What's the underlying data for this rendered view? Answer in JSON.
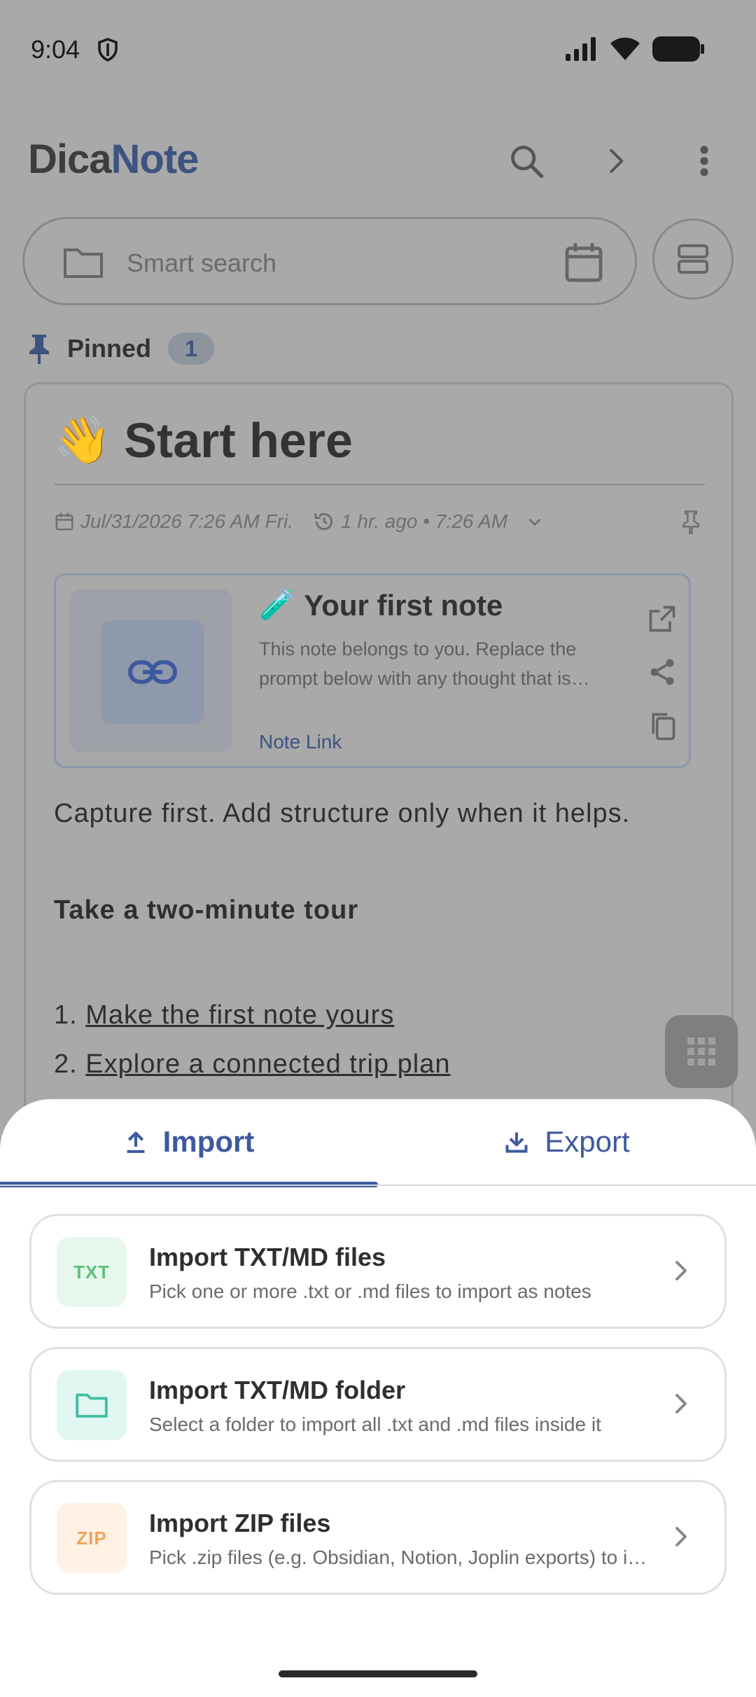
{
  "status_bar": {
    "time": "9:04"
  },
  "header": {
    "logo_part1": "Dica",
    "logo_part2": "Note"
  },
  "search": {
    "placeholder": "Smart search"
  },
  "pinned": {
    "label": "Pinned",
    "count": "1"
  },
  "note": {
    "emoji": "👋",
    "title": "Start here",
    "date": "Jul/31/2026 7:26 AM Fri.",
    "updated": "1 hr. ago • 7:26 AM",
    "link_card": {
      "emoji": "🧪",
      "title": "Your first note",
      "description": "This note belongs to you. Replace the prompt below with any thought that is…",
      "label": "Note Link"
    },
    "body_line": "Capture first. Add structure only when it helps.",
    "tour_heading": "Take a two-minute tour",
    "tour_items": [
      {
        "num": "1.",
        "text": "Make the first note yours"
      },
      {
        "num": "2.",
        "text": "Explore a connected trip plan"
      }
    ]
  },
  "sheet": {
    "tabs": {
      "import": "Import",
      "export": "Export",
      "active": "import"
    },
    "options": [
      {
        "badge": "TXT",
        "title": "Import TXT/MD files",
        "subtitle": "Pick one or more .txt or .md files to import as notes",
        "icon": "txt-badge-icon"
      },
      {
        "badge": "",
        "title": "Import TXT/MD folder",
        "subtitle": "Select a folder to import all .txt and .md files inside it",
        "icon": "folder-icon"
      },
      {
        "badge": "ZIP",
        "title": "Import ZIP files",
        "subtitle": "Pick .zip files (e.g. Obsidian, Notion, Joplin exports) to i…",
        "icon": "zip-badge-icon"
      }
    ]
  },
  "colors": {
    "accent": "#3d5a9e",
    "txt_bg": "#e8f7ec",
    "txt_fg": "#5cc27a",
    "folder_bg": "#e2f6f2",
    "folder_fg": "#3fbfa2",
    "zip_bg": "#fff1e4",
    "zip_fg": "#f2a25a"
  }
}
